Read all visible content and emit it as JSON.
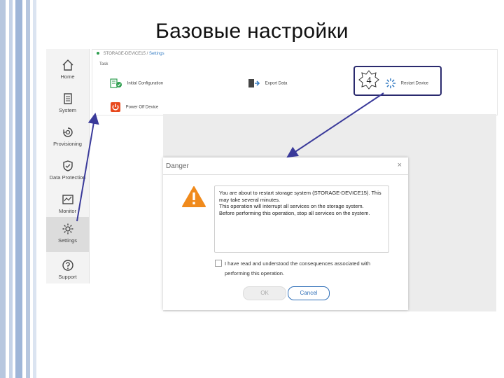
{
  "slide_title": "Базовые настройки",
  "sidebar": {
    "items": [
      {
        "label": "Home",
        "icon": "home-icon"
      },
      {
        "label": "System",
        "icon": "system-icon"
      },
      {
        "label": "Provisioning",
        "icon": "provisioning-icon"
      },
      {
        "label": "Data Protection",
        "icon": "shield-icon"
      },
      {
        "label": "Monitor",
        "icon": "monitor-icon"
      },
      {
        "label": "Settings",
        "icon": "gear-icon"
      },
      {
        "label": "Support",
        "icon": "help-icon"
      }
    ],
    "active": "Settings"
  },
  "breadcrumb": {
    "device": "STORAGE-DEVICE15",
    "separator": "/",
    "page": "Settings"
  },
  "tasks": {
    "label": "Task",
    "items": [
      {
        "label": "Initial Configuration",
        "icon": "initial-config-icon"
      },
      {
        "label": "Export Data",
        "icon": "export-icon"
      },
      {
        "label": "Restart Device",
        "icon": "restart-icon"
      },
      {
        "label": "Power Off Device",
        "icon": "power-icon"
      }
    ]
  },
  "callout_number": "4",
  "dialog": {
    "title": "Danger",
    "close": "×",
    "message_lines": [
      "You are about to restart storage system (STORAGE-DEVICE15). This may take several minutes.",
      "This operation will interrupt all services on the storage system.",
      "Before performing this operation, stop all services on the system."
    ],
    "checkbox_label": "I have read and understood the consequences associated with performing this operation.",
    "ok_label": "OK",
    "cancel_label": "Cancel"
  },
  "colors": {
    "warning": "#f08a1c",
    "accent": "#2f6fb8",
    "arrow": "#3a3a9a",
    "success": "#2e9e4f",
    "danger": "#e8491d"
  }
}
